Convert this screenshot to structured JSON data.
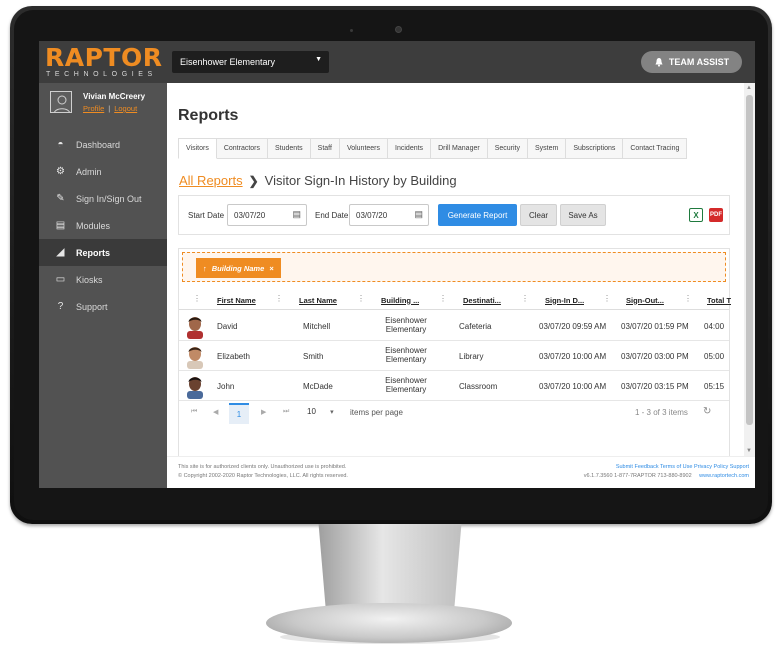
{
  "topbar": {
    "logo_word": "RAPTOR",
    "logo_sub": "TECHNOLOGIES",
    "school": "Eisenhower Elementary",
    "team_assist": "TEAM ASSIST"
  },
  "user": {
    "name": "Vivian McCreery",
    "profile": "Profile",
    "logout": "Logout",
    "separator": "|"
  },
  "sidebar": {
    "items": [
      {
        "label": "Dashboard",
        "icon": "dashboard-icon",
        "glyph": "◓"
      },
      {
        "label": "Admin",
        "icon": "gear-icon",
        "glyph": "⚙"
      },
      {
        "label": "Sign In/Sign Out",
        "icon": "sign-in-icon",
        "glyph": "✎"
      },
      {
        "label": "Modules",
        "icon": "modules-icon",
        "glyph": "▤"
      },
      {
        "label": "Reports",
        "icon": "reports-icon",
        "glyph": "◢"
      },
      {
        "label": "Kiosks",
        "icon": "monitor-icon",
        "glyph": "▭"
      },
      {
        "label": "Support",
        "icon": "question-icon",
        "glyph": "?"
      }
    ],
    "active_index": 4
  },
  "page": {
    "title": "Reports"
  },
  "tabs": [
    "Visitors",
    "Contractors",
    "Students",
    "Staff",
    "Volunteers",
    "Incidents",
    "Drill Manager",
    "Security",
    "System",
    "Subscriptions",
    "Contact Tracing"
  ],
  "breadcrumb": {
    "parent": "All Reports",
    "separator": "❯",
    "current": "Visitor Sign-In History by Building"
  },
  "filters": {
    "start_label": "Start Date",
    "start_value": "03/07/20",
    "end_label": "End Date",
    "end_value": "03/07/20",
    "generate": "Generate Report",
    "clear": "Clear",
    "save_as": "Save As",
    "excel": "X",
    "pdf": "PDF"
  },
  "grid": {
    "group_chip": "Building Name",
    "group_arrow": "↑",
    "group_remove": "×",
    "menu_glyph": "⋮",
    "columns": [
      "First Name",
      "Last Name",
      "Building ...",
      "Destinati...",
      "Sign-In D...",
      "Sign-Out...",
      "Total T"
    ],
    "rows": [
      {
        "first": "David",
        "last": "Mitchell",
        "building": "Eisenhower Elementary",
        "b1": "Eisenhower",
        "b2": "Elementary",
        "dest": "Cafeteria",
        "signin": "03/07/20 09:59 AM",
        "signout": "03/07/20 01:59 PM",
        "total": "04:00",
        "skin": "#a0674a",
        "hair": "#2a1a10",
        "shirt": "#b03030"
      },
      {
        "first": "Elizabeth",
        "last": "Smith",
        "b1": "Eisenhower",
        "b2": "Elementary",
        "dest": "Library",
        "signin": "03/07/20 10:00 AM",
        "signout": "03/07/20 03:00 PM",
        "total": "05:00",
        "skin": "#c08a66",
        "hair": "#3a2416",
        "shirt": "#d8c8b8"
      },
      {
        "first": "John",
        "last": "McDade",
        "b1": "Eisenhower",
        "b2": "Elementary",
        "dest": "Classroom",
        "signin": "03/07/20 10:00 AM",
        "signout": "03/07/20 03:15 PM",
        "total": "05:15",
        "skin": "#6a4230",
        "hair": "#1a1210",
        "shirt": "#4a6a9a"
      }
    ]
  },
  "pager": {
    "first": "⏮",
    "prev": "◀",
    "current": "1",
    "next": "▶",
    "last": "⏭",
    "page_size": "10",
    "size_caret": "▾",
    "items_label": "items per page",
    "info": "1 - 3 of 3 items",
    "refresh": "↻"
  },
  "footer": {
    "left1": "This site is for authorized clients only. Unauthorized use is prohibited.",
    "left2": "© Copyright 2002-2020 Raptor Technologies, LLC. All rights reserved.",
    "links": "Submit Feedback    Terms of Use    Privacy Policy    Support",
    "right2": "v6.1.7.3560   1-877-7RAPTOR   713-880-8902",
    "website": "www.raptortech.com"
  },
  "colors": {
    "accent": "#ef8c22",
    "primary": "#2f8ce4",
    "sidebar": "#525252",
    "topbar": "#3d3d3d"
  }
}
